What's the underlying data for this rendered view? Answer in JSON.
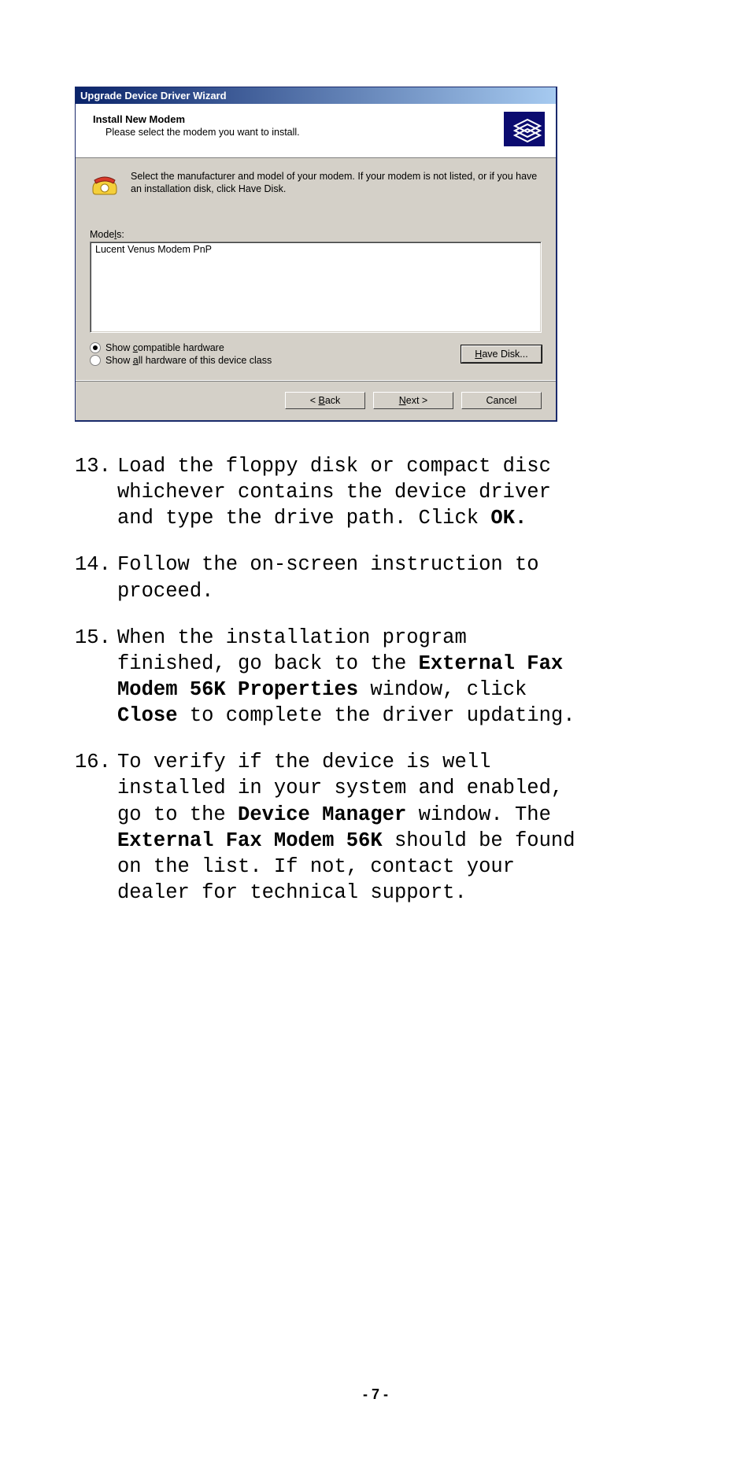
{
  "wizard": {
    "title": "Upgrade Device Driver Wizard",
    "header": {
      "title": "Install New Modem",
      "subtitle": "Please select the modem you want to install."
    },
    "body": {
      "instruction": "Select the manufacturer and model of your modem. If your modem is not listed, or if you have an installation disk, click Have Disk.",
      "models_label": "Models:",
      "models_item": "Lucent Venus Modem PnP",
      "radio_compatible": "Show compatible hardware",
      "radio_all": "Show all hardware of this device class",
      "radio_selected": "compatible",
      "have_disk_label": "Have Disk..."
    },
    "footer": {
      "back": "< Back",
      "next": "Next >",
      "cancel": "Cancel"
    }
  },
  "doc": {
    "items": [
      {
        "num": "13.",
        "runs": [
          {
            "t": "Load the floppy disk or compact disc whichever contains the device driver and type the drive path. Click "
          },
          {
            "t": "OK.",
            "b": true
          }
        ]
      },
      {
        "num": "14.",
        "runs": [
          {
            "t": "Follow the on-screen instruction to proceed."
          }
        ]
      },
      {
        "num": "15.",
        "runs": [
          {
            "t": "When the installation program finished, go back to the "
          },
          {
            "t": "External Fax Modem 56K Properties",
            "b": true
          },
          {
            "t": " window, click "
          },
          {
            "t": "Close",
            "b": true
          },
          {
            "t": " to complete the driver updating."
          }
        ]
      },
      {
        "num": "16.",
        "runs": [
          {
            "t": "To verify if the device is well installed in your system and enabled, go to the "
          },
          {
            "t": "Device Manager",
            "b": true
          },
          {
            "t": " window. The "
          },
          {
            "t": "External Fax Modem 56K",
            "b": true
          },
          {
            "t": " should be found on the list. If not, contact your dealer for technical support."
          }
        ]
      }
    ]
  },
  "page_number": "- 7 -"
}
